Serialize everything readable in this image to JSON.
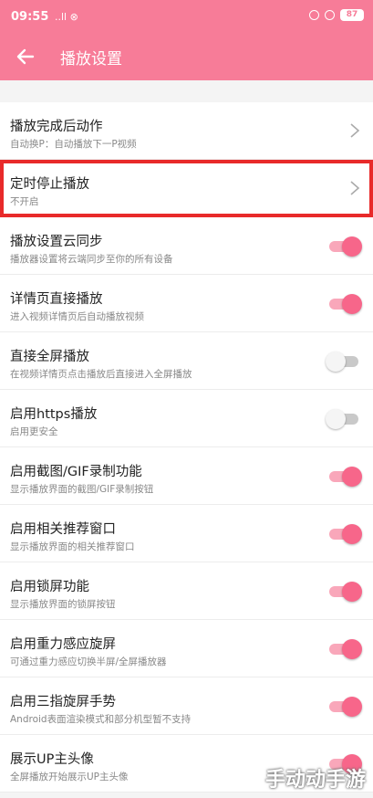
{
  "status_bar": {
    "time": "09:55",
    "signal": "..ll ⊗",
    "battery": "87"
  },
  "header": {
    "title": "播放设置"
  },
  "settings": [
    {
      "title": "播放完成后动作",
      "subtitle": "自动换P：自动播放下一P视频",
      "control": "chevron"
    },
    {
      "title": "定时停止播放",
      "subtitle": "不开启",
      "control": "chevron",
      "highlighted": true
    },
    {
      "title": "播放设置云同步",
      "subtitle": "播放器设置将云端同步至你的所有设备",
      "control": "toggle",
      "on": true
    },
    {
      "title": "详情页直接播放",
      "subtitle": "进入视频详情页后自动播放视频",
      "control": "toggle",
      "on": true
    },
    {
      "title": "直接全屏播放",
      "subtitle": "在视频详情页点击播放后直接进入全屏播放",
      "control": "toggle",
      "on": false
    },
    {
      "title": "启用https播放",
      "subtitle": "启用更安全",
      "control": "toggle",
      "on": false
    },
    {
      "title": "启用截图/GIF录制功能",
      "subtitle": "显示播放界面的截图/GIF录制按钮",
      "control": "toggle",
      "on": true
    },
    {
      "title": "启用相关推荐窗口",
      "subtitle": "显示播放界面的相关推荐窗口",
      "control": "toggle",
      "on": true
    },
    {
      "title": "启用锁屏功能",
      "subtitle": "显示播放界面的锁屏按钮",
      "control": "toggle",
      "on": true
    },
    {
      "title": "启用重力感应旋屏",
      "subtitle": "可通过重力感应切换半屏/全屏播放器",
      "control": "toggle",
      "on": true
    },
    {
      "title": "启用三指旋屏手势",
      "subtitle": "Android表面渲染模式和部分机型暂不支持",
      "control": "toggle",
      "on": true
    },
    {
      "title": "展示UP主头像",
      "subtitle": "全屏播放开始展示UP主头像",
      "control": "toggle",
      "on": true
    }
  ],
  "watermark": "手动动手游",
  "colors": {
    "accent": "#f77c98",
    "toggle_on": "#f7668a",
    "highlight": "#e82a2a"
  }
}
